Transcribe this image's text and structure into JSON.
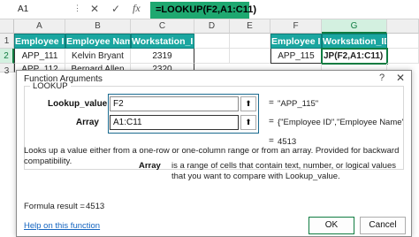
{
  "formula_bar": {
    "name_box": "A1",
    "cancel_glyph": "✕",
    "enter_glyph": "✓",
    "fx_label": "fx",
    "formula": "=LOOKUP(F2,A1:C11)"
  },
  "sheet": {
    "columns": [
      "A",
      "B",
      "C",
      "D",
      "E",
      "F",
      "G"
    ],
    "rows": [
      "1",
      "2",
      "3"
    ],
    "left_table": {
      "headers": [
        "Employee ID",
        "Employee Name",
        "Workstation_ID"
      ],
      "row2": [
        "APP_111",
        "Kelvin Bryant",
        "2319"
      ],
      "row3": [
        "APP_112",
        "Bernard Allen",
        "2320"
      ]
    },
    "right_table": {
      "headers": [
        "Employee ID",
        "Workstation_ID"
      ],
      "row2": [
        "APP_115",
        "JP(F2,A1:C11)"
      ]
    }
  },
  "dialog": {
    "title": "Function Arguments",
    "help_glyph": "?",
    "close_glyph": "✕",
    "function_name": "LOOKUP",
    "args": [
      {
        "label": "Lookup_value",
        "value": "F2",
        "result": "\"APP_115\""
      },
      {
        "label": "Array",
        "value": "A1:C11",
        "result": "{\"Employee ID\",\"Employee Name\",\"Workstati..."
      }
    ],
    "equals": "=",
    "function_result": "4513",
    "description": "Looks up a value either from a one-row or one-column range or from an array. Provided for backward compatibility.",
    "arg_desc_name": "Array",
    "arg_desc_text": "is a range of cells that contain text, number, or logical values that you want to compare with Lookup_value.",
    "formula_result_label": "Formula result =",
    "formula_result_value": "4513",
    "help_link": "Help on this function",
    "ok_label": "OK",
    "cancel_label": "Cancel"
  },
  "colors": {
    "header_teal": "#1aa6a0",
    "formula_green": "#1ea870",
    "excel_green": "#107c41"
  }
}
